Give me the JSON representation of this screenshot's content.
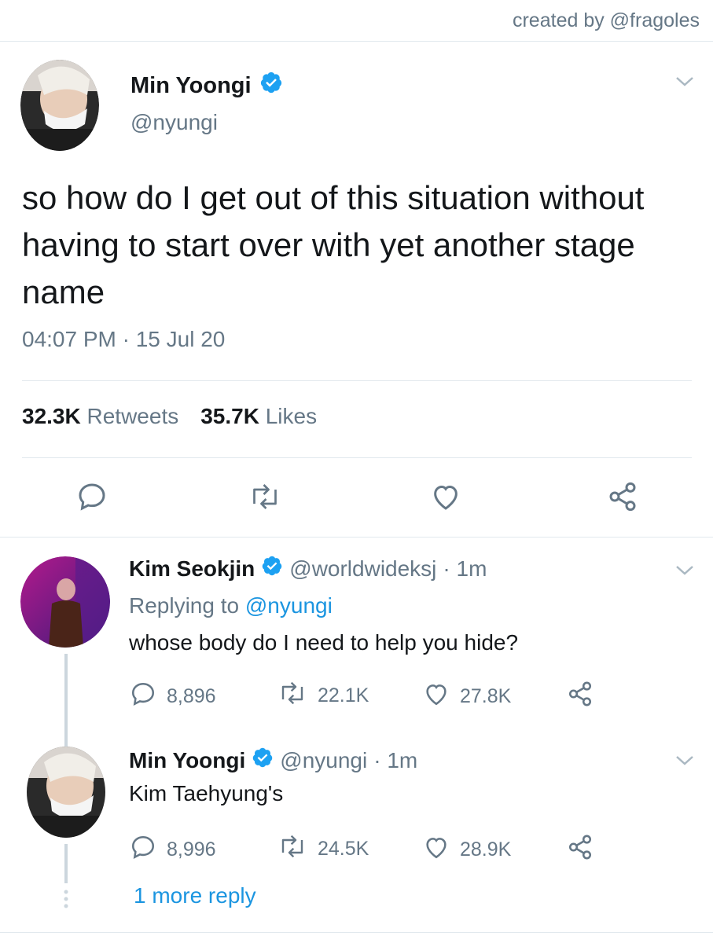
{
  "credit": "created by @fragoles",
  "main_tweet": {
    "name": "Min Yoongi",
    "handle": "@nyungi",
    "text": "so how do I get out of this situation without having to start over with yet another stage name",
    "timestamp": "04:07 PM · 15 Jul 20",
    "retweets_count": "32.3K",
    "retweets_label": "Retweets",
    "likes_count": "35.7K",
    "likes_label": "Likes"
  },
  "replies": [
    {
      "name": "Kim Seokjin",
      "handle": "@worldwideksj",
      "time": "· 1m",
      "replying_prefix": "Replying to",
      "replying_to": "@nyungi",
      "text": "whose body do I need to help you hide?",
      "replies": "8,896",
      "retweets": "22.1K",
      "likes": "27.8K"
    },
    {
      "name": "Min Yoongi",
      "handle": "@nyungi",
      "time": "· 1m",
      "text": "Kim Taehyung's",
      "replies": "8,996",
      "retweets": "24.5K",
      "likes": "28.9K"
    }
  ],
  "more_reply": "1 more reply",
  "colors": {
    "accent": "#1b95e0",
    "muted": "#657786",
    "divider": "#e1e8ed",
    "verified": "#1da1f2"
  },
  "icons": [
    "reply-icon",
    "retweet-icon",
    "like-icon",
    "share-icon",
    "verified-icon",
    "chevron-down-icon"
  ]
}
